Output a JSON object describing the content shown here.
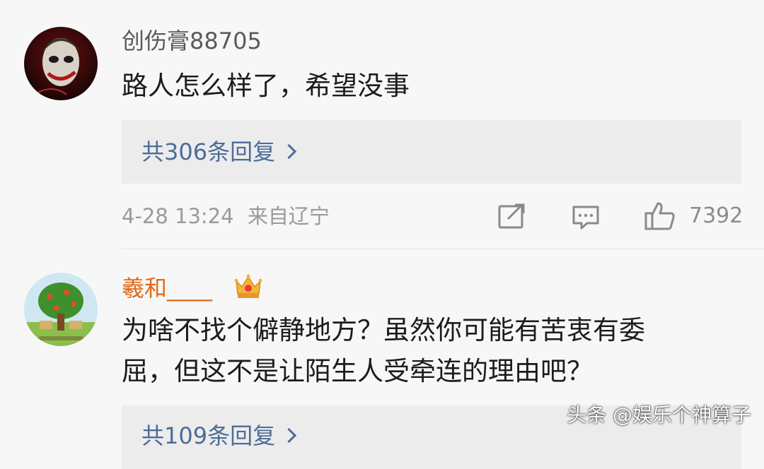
{
  "comments": [
    {
      "username": "创伤膏88705",
      "text_lines": [
        "路人怎么样了，希望没事"
      ],
      "replies_label": "共306条回复",
      "timestamp": "4-28 13:24",
      "location": "来自辽宁",
      "like_count": "7392",
      "avatar_icon": "joker-avatar-icon",
      "username_color": "#5a5a5a"
    },
    {
      "username": "羲和____",
      "text_lines": [
        "为啥不找个僻静地方？虽然你可能有苦衷有委",
        "屈，但这不是让陌生人受牵连的理由吧？"
      ],
      "replies_label": "共109条回复",
      "avatar_icon": "tree-avatar-icon",
      "badge_icon": "crown-badge-icon",
      "username_color": "#e06a1b"
    }
  ],
  "icons": {
    "repost": "repost-icon",
    "comment": "comment-icon",
    "like": "thumbs-up-icon"
  },
  "colors": {
    "link": "#4d6c99",
    "meta": "#9a9a9a",
    "reply_bg": "#ececec"
  },
  "watermark": "头条 @娱乐个神算子"
}
